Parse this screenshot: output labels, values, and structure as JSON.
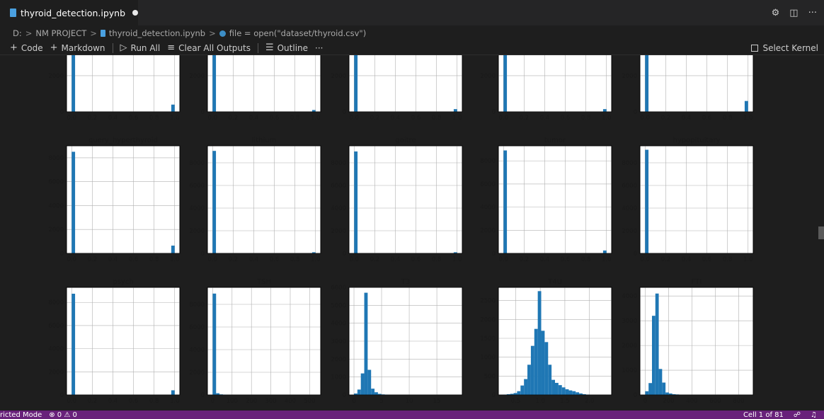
{
  "tab": {
    "title": "thyroid_detection.ipynb"
  },
  "tab_actions": {
    "settings_icon": "⚙",
    "split_icon": "◫",
    "more_icon": "···"
  },
  "breadcrumb": {
    "drive": "D:",
    "folder": "NM PROJECT",
    "file": "thyroid_detection.ipynb",
    "cell": "file = open(\"dataset/thyroid.csv\")",
    "separator": ">"
  },
  "toolbar": {
    "code": "Code",
    "markdown": "Markdown",
    "run_all": "Run All",
    "clear_outputs": "Clear All Outputs",
    "outline": "Outline",
    "more": "···",
    "select_kernel": "Select Kernel"
  },
  "status": {
    "mode": "ricted Mode",
    "problems": "⊗ 0 ⚠ 0",
    "cell": "Cell 1 of 81"
  },
  "colors": {
    "bar": "#1f77b4",
    "statusbar": "#68217a",
    "grid": "#b0b0b0"
  },
  "chart_data": [
    {
      "type": "bar",
      "row": 0,
      "col": 0,
      "title": "",
      "x_ticks": [
        "0.0",
        "0.2",
        "0.4",
        "0.6",
        "0.8",
        "1.0"
      ],
      "y_ticks": [
        "0",
        "2000",
        "4000"
      ],
      "xlim": [
        -0.05,
        1.05
      ],
      "ylim": [
        0,
        4700
      ],
      "bins": [
        {
          "x": 0.0,
          "w": 0.033,
          "h": 9000
        },
        {
          "x": 0.967,
          "w": 0.033,
          "h": 400
        }
      ]
    },
    {
      "type": "bar",
      "row": 0,
      "col": 1,
      "title": "",
      "x_ticks": [
        "0.0",
        "0.2",
        "0.4",
        "0.6",
        "0.8",
        "1.0"
      ],
      "y_ticks": [
        "0",
        "2000",
        "4000"
      ],
      "xlim": [
        -0.05,
        1.05
      ],
      "ylim": [
        0,
        4700
      ],
      "bins": [
        {
          "x": 0.0,
          "w": 0.033,
          "h": 9000
        },
        {
          "x": 0.967,
          "w": 0.033,
          "h": 100
        }
      ]
    },
    {
      "type": "bar",
      "row": 0,
      "col": 2,
      "title": "",
      "x_ticks": [
        "0.0",
        "0.2",
        "0.4",
        "0.6",
        "0.8",
        "1.0"
      ],
      "y_ticks": [
        "0",
        "2000",
        "4000"
      ],
      "xlim": [
        -0.05,
        1.05
      ],
      "ylim": [
        0,
        4700
      ],
      "bins": [
        {
          "x": 0.0,
          "w": 0.033,
          "h": 9000
        },
        {
          "x": 0.967,
          "w": 0.033,
          "h": 150
        }
      ]
    },
    {
      "type": "bar",
      "row": 0,
      "col": 3,
      "title": "",
      "x_ticks": [
        "0.0",
        "0.2",
        "0.4",
        "0.6",
        "0.8",
        "1.0"
      ],
      "y_ticks": [
        "0",
        "2000",
        "4000"
      ],
      "xlim": [
        -0.05,
        1.05
      ],
      "ylim": [
        0,
        4700
      ],
      "bins": [
        {
          "x": 0.0,
          "w": 0.033,
          "h": 9000
        },
        {
          "x": 0.967,
          "w": 0.033,
          "h": 150
        }
      ]
    },
    {
      "type": "bar",
      "row": 0,
      "col": 4,
      "title": "",
      "x_ticks": [
        "0.0",
        "0.2",
        "0.4",
        "0.6",
        "0.8",
        "1.0"
      ],
      "y_ticks": [
        "0",
        "2000",
        "4000"
      ],
      "xlim": [
        -0.05,
        1.05
      ],
      "ylim": [
        0,
        4700
      ],
      "bins": [
        {
          "x": 0.0,
          "w": 0.033,
          "h": 9000
        },
        {
          "x": 0.967,
          "w": 0.033,
          "h": 600
        }
      ]
    },
    {
      "type": "bar",
      "row": 1,
      "col": 0,
      "title": "query_hyperthyroid",
      "x_ticks": [
        "0.0",
        "0.2",
        "0.4",
        "0.6",
        "0.8",
        "1.0"
      ],
      "y_ticks": [
        "0",
        "2000",
        "4000",
        "6000",
        "8000"
      ],
      "xlim": [
        -0.05,
        1.05
      ],
      "ylim": [
        0,
        9000
      ],
      "bins": [
        {
          "x": 0.0,
          "w": 0.033,
          "h": 8500
        },
        {
          "x": 0.967,
          "w": 0.033,
          "h": 650
        }
      ]
    },
    {
      "type": "bar",
      "row": 1,
      "col": 1,
      "title": "lithium",
      "x_ticks": [
        "0.0",
        "0.2",
        "0.4",
        "0.6",
        "0.8",
        "1.0"
      ],
      "y_ticks": [
        "0",
        "2000",
        "4000",
        "6000",
        "8000"
      ],
      "xlim": [
        -0.05,
        1.05
      ],
      "ylim": [
        0,
        9500
      ],
      "bins": [
        {
          "x": 0.0,
          "w": 0.033,
          "h": 9050
        },
        {
          "x": 0.967,
          "w": 0.033,
          "h": 100
        }
      ]
    },
    {
      "type": "bar",
      "row": 1,
      "col": 2,
      "title": "goitre",
      "x_ticks": [
        "0.0",
        "0.2",
        "0.4",
        "0.6",
        "0.8",
        "1.0"
      ],
      "y_ticks": [
        "0",
        "2000",
        "4000",
        "6000",
        "8000"
      ],
      "xlim": [
        -0.05,
        1.05
      ],
      "ylim": [
        0,
        9500
      ],
      "bins": [
        {
          "x": 0.0,
          "w": 0.033,
          "h": 9000
        },
        {
          "x": 0.967,
          "w": 0.033,
          "h": 100
        }
      ]
    },
    {
      "type": "bar",
      "row": 1,
      "col": 3,
      "title": "tumor",
      "x_ticks": [
        "0.0",
        "0.2",
        "0.4",
        "0.6",
        "0.8",
        "1.0"
      ],
      "y_ticks": [
        "0",
        "2000",
        "4000",
        "6000",
        "8000"
      ],
      "xlim": [
        -0.05,
        1.05
      ],
      "ylim": [
        0,
        9300
      ],
      "bins": [
        {
          "x": 0.0,
          "w": 0.033,
          "h": 8900
        },
        {
          "x": 0.967,
          "w": 0.033,
          "h": 250
        }
      ]
    },
    {
      "type": "bar",
      "row": 1,
      "col": 4,
      "title": "hypopituitary",
      "x_ticks": [
        "0.0",
        "0.2",
        "0.4",
        "0.6",
        "0.8",
        "1.0"
      ],
      "y_ticks": [
        "0",
        "2000",
        "4000",
        "6000",
        "8000"
      ],
      "xlim": [
        -0.05,
        1.05
      ],
      "ylim": [
        0,
        9500
      ],
      "bins": [
        {
          "x": 0.0,
          "w": 0.033,
          "h": 9150
        }
      ]
    },
    {
      "type": "bar",
      "row": 2,
      "col": 0,
      "title": "psych",
      "x_ticks": [
        "0.0",
        "0.2",
        "0.4",
        "0.6",
        "0.8",
        "1.0"
      ],
      "y_ticks": [
        "0",
        "2000",
        "4000",
        "6000",
        "8000"
      ],
      "xlim": [
        -0.05,
        1.05
      ],
      "ylim": [
        0,
        9300
      ],
      "bins": [
        {
          "x": 0.0,
          "w": 0.033,
          "h": 8750
        },
        {
          "x": 0.967,
          "w": 0.033,
          "h": 400
        }
      ]
    },
    {
      "type": "bar",
      "row": 2,
      "col": 1,
      "title": "TSH",
      "x_ticks": [
        "0",
        "100",
        "200",
        "300",
        "400",
        "500"
      ],
      "y_ticks": [
        "0",
        "2000",
        "4000",
        "6000",
        "8000"
      ],
      "xlim": [
        -27,
        557
      ],
      "ylim": [
        0,
        9500
      ],
      "bins": [
        {
          "x": 0,
          "w": 17.7,
          "h": 8950
        },
        {
          "x": 17.7,
          "w": 17.7,
          "h": 150
        },
        {
          "x": 35.4,
          "w": 17.7,
          "h": 50
        },
        {
          "x": 53.1,
          "w": 17.7,
          "h": 30
        }
      ]
    },
    {
      "type": "bar",
      "row": 2,
      "col": 2,
      "title": "T3",
      "x_ticks": [
        "0",
        "5",
        "10",
        "15"
      ],
      "y_ticks": [
        "0",
        "1000",
        "2000",
        "3000",
        "4000",
        "5000",
        "6000"
      ],
      "xlim": [
        -0.9,
        19.6
      ],
      "ylim": [
        0,
        6000
      ],
      "bins": [
        {
          "x": 0,
          "w": 0.62,
          "h": 80
        },
        {
          "x": 0.62,
          "w": 0.62,
          "h": 300
        },
        {
          "x": 1.24,
          "w": 0.62,
          "h": 1200
        },
        {
          "x": 1.86,
          "w": 0.62,
          "h": 5700
        },
        {
          "x": 2.48,
          "w": 0.62,
          "h": 1400
        },
        {
          "x": 3.1,
          "w": 0.62,
          "h": 350
        },
        {
          "x": 3.72,
          "w": 0.62,
          "h": 150
        },
        {
          "x": 4.34,
          "w": 0.62,
          "h": 60
        },
        {
          "x": 4.96,
          "w": 0.62,
          "h": 30
        },
        {
          "x": 5.58,
          "w": 0.62,
          "h": 20
        }
      ]
    },
    {
      "type": "bar",
      "row": 2,
      "col": 3,
      "title": "T4U",
      "x_ticks": [
        "0.5",
        "1.0",
        "1.5",
        "2.0"
      ],
      "y_ticks": [
        "0",
        "500",
        "1000",
        "1500",
        "2000",
        "2500"
      ],
      "xlim": [
        0.15,
        2.45
      ],
      "ylim": [
        0,
        2850
      ],
      "bins": [
        {
          "x": 0.25,
          "w": 0.07,
          "h": 10
        },
        {
          "x": 0.32,
          "w": 0.07,
          "h": 20
        },
        {
          "x": 0.39,
          "w": 0.07,
          "h": 30
        },
        {
          "x": 0.46,
          "w": 0.07,
          "h": 50
        },
        {
          "x": 0.53,
          "w": 0.07,
          "h": 100
        },
        {
          "x": 0.6,
          "w": 0.07,
          "h": 250
        },
        {
          "x": 0.67,
          "w": 0.07,
          "h": 420
        },
        {
          "x": 0.74,
          "w": 0.07,
          "h": 800
        },
        {
          "x": 0.81,
          "w": 0.07,
          "h": 1300
        },
        {
          "x": 0.88,
          "w": 0.07,
          "h": 1750
        },
        {
          "x": 0.95,
          "w": 0.07,
          "h": 2750
        },
        {
          "x": 1.02,
          "w": 0.07,
          "h": 1700
        },
        {
          "x": 1.09,
          "w": 0.07,
          "h": 1400
        },
        {
          "x": 1.16,
          "w": 0.07,
          "h": 800
        },
        {
          "x": 1.23,
          "w": 0.07,
          "h": 400
        },
        {
          "x": 1.3,
          "w": 0.07,
          "h": 320
        },
        {
          "x": 1.37,
          "w": 0.07,
          "h": 260
        },
        {
          "x": 1.44,
          "w": 0.07,
          "h": 200
        },
        {
          "x": 1.51,
          "w": 0.07,
          "h": 150
        },
        {
          "x": 1.58,
          "w": 0.07,
          "h": 120
        },
        {
          "x": 1.65,
          "w": 0.07,
          "h": 100
        },
        {
          "x": 1.72,
          "w": 0.07,
          "h": 70
        },
        {
          "x": 1.79,
          "w": 0.07,
          "h": 40
        },
        {
          "x": 1.86,
          "w": 0.07,
          "h": 20
        },
        {
          "x": 1.93,
          "w": 0.07,
          "h": 10
        }
      ]
    },
    {
      "type": "bar",
      "row": 2,
      "col": 4,
      "title": "FTI",
      "x_ticks": [
        "0",
        "200",
        "400",
        "600",
        "800"
      ],
      "y_ticks": [
        "0",
        "1000",
        "2000",
        "3000",
        "4000"
      ],
      "xlim": [
        -45,
        925
      ],
      "ylim": [
        0,
        4350
      ],
      "bins": [
        {
          "x": 0,
          "w": 29,
          "h": 150
        },
        {
          "x": 29,
          "w": 29,
          "h": 480
        },
        {
          "x": 58,
          "w": 29,
          "h": 3200
        },
        {
          "x": 87,
          "w": 29,
          "h": 4100
        },
        {
          "x": 116,
          "w": 29,
          "h": 1050
        },
        {
          "x": 145,
          "w": 29,
          "h": 500
        },
        {
          "x": 174,
          "w": 29,
          "h": 100
        },
        {
          "x": 203,
          "w": 29,
          "h": 60
        },
        {
          "x": 232,
          "w": 29,
          "h": 30
        },
        {
          "x": 261,
          "w": 29,
          "h": 20
        }
      ]
    }
  ]
}
